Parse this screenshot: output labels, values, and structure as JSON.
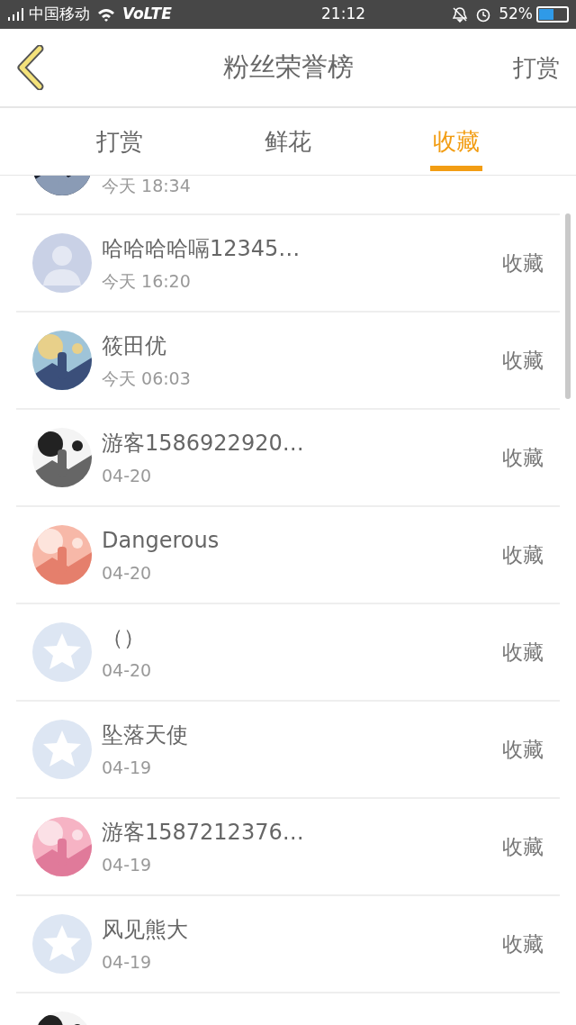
{
  "status_bar": {
    "carrier": "中国移动",
    "network": "VoLTE",
    "time": "21:12",
    "battery": "52%"
  },
  "header": {
    "title": "粉丝荣誉榜",
    "action": "打赏"
  },
  "tabs": [
    {
      "label": "打赏",
      "selected": false
    },
    {
      "label": "鲜花",
      "selected": false
    },
    {
      "label": "收藏",
      "selected": true
    }
  ],
  "rows": [
    {
      "kind": "picture",
      "time": "今天 18:34"
    },
    {
      "kind": "default",
      "name": "哈哈哈哈嗝12345…",
      "time": "今天 16:20",
      "action": "收藏"
    },
    {
      "kind": "picture",
      "name": "筱田优",
      "time": "今天 06:03",
      "action": "收藏"
    },
    {
      "kind": "picture",
      "name": "游客1586922920…",
      "time": "04-20",
      "action": "收藏"
    },
    {
      "kind": "picture",
      "name": "Dangerous",
      "time": "04-20",
      "action": "收藏"
    },
    {
      "kind": "qzone",
      "name": "（）",
      "time": "04-20",
      "action": "收藏"
    },
    {
      "kind": "qzone",
      "name": "坠落天使",
      "time": "04-19",
      "action": "收藏"
    },
    {
      "kind": "picture",
      "name": "游客1587212376…",
      "time": "04-19",
      "action": "收藏"
    },
    {
      "kind": "qzone",
      "name": "风见熊大",
      "time": "04-19",
      "action": "收藏"
    },
    {
      "kind": "picture"
    }
  ]
}
